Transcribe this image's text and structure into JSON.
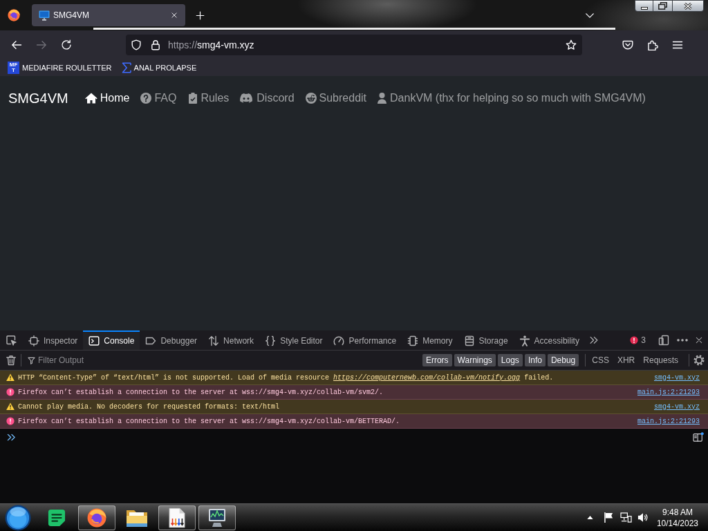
{
  "browser": {
    "tabs": [
      {
        "title": "SMG4VM",
        "selected": true
      }
    ],
    "nav_buttons": [
      {
        "kind": "back",
        "disabled": false
      },
      {
        "kind": "forward",
        "disabled": true
      },
      {
        "kind": "reload",
        "disabled": false
      }
    ],
    "address": {
      "scheme": "https://",
      "host": "smg4-vm.xyz"
    },
    "bookmarks": [
      {
        "kind": "letters",
        "icon_text": [
          "MF",
          "T"
        ],
        "label": "MEDIAFIRE ROULETTER"
      },
      {
        "kind": "sigma",
        "label": "ANAL PROLAPSE"
      }
    ]
  },
  "page": {
    "brand": "SMG4VM",
    "nav": [
      {
        "kind": "home",
        "label": "Home",
        "selected": true
      },
      {
        "kind": "help",
        "label": "FAQ",
        "selected": false
      },
      {
        "kind": "rules",
        "label": "Rules",
        "selected": false
      },
      {
        "kind": "chat",
        "label": "Discord",
        "selected": false
      },
      {
        "kind": "forum",
        "label": "Subreddit",
        "selected": false
      },
      {
        "kind": "user",
        "label": "DankVM (thx for helping so so much with SMG4VM)",
        "selected": false
      }
    ]
  },
  "devtools": {
    "tools": [
      {
        "kind": "inspector",
        "label": "Inspector",
        "selected": false
      },
      {
        "kind": "console",
        "label": "Console",
        "selected": true
      },
      {
        "kind": "debugger",
        "label": "Debugger",
        "selected": false
      },
      {
        "kind": "network",
        "label": "Network",
        "selected": false
      },
      {
        "kind": "style",
        "label": "Style Editor",
        "selected": false
      },
      {
        "kind": "performance",
        "label": "Performance",
        "selected": false
      },
      {
        "kind": "memory",
        "label": "Memory",
        "selected": false
      },
      {
        "kind": "storage",
        "label": "Storage",
        "selected": false
      },
      {
        "kind": "accessibility",
        "label": "Accessibility",
        "selected": false
      }
    ],
    "error_count": "3",
    "filter": {
      "placeholder": "Filter Output"
    },
    "levels": [
      {
        "label": "Errors",
        "selected": true
      },
      {
        "label": "Warnings",
        "selected": true
      },
      {
        "label": "Logs",
        "selected": true
      },
      {
        "label": "Info",
        "selected": true
      },
      {
        "label": "Debug",
        "selected": true
      }
    ],
    "request_filters": [
      {
        "label": "CSS",
        "selected": false
      },
      {
        "label": "XHR",
        "selected": false
      },
      {
        "label": "Requests",
        "selected": false
      }
    ],
    "messages": [
      {
        "kind": "warning",
        "text": "HTTP “Content-Type” of “text/html” is not supported. Load of media resource ",
        "link": "https://computernewb.com/collab-vm/notify.ogg",
        "text_after": " failed.",
        "source": "smg4-vm.xyz"
      },
      {
        "kind": "error",
        "text": "Firefox can’t establish a connection to the server at wss://smg4-vm.xyz/collab-vm/svm2/.",
        "source": "main.js:2:21293"
      },
      {
        "kind": "warning",
        "text": "Cannot play media. No decoders for requested formats: text/html",
        "source": "smg4-vm.xyz"
      },
      {
        "kind": "error",
        "text": "Firefox can’t establish a connection to the server at wss://smg4-vm.xyz/collab-vm/BETTERAD/.",
        "source": "main.js:2:21293"
      }
    ]
  },
  "taskbar": {
    "apps": [
      {
        "kind": "notes",
        "running": false
      },
      {
        "kind": "browser",
        "running": true
      },
      {
        "kind": "folder",
        "running": false
      },
      {
        "kind": "document",
        "running": true
      },
      {
        "kind": "monitor",
        "running": true
      }
    ],
    "time": "9:48 AM",
    "date": "10/14/2023"
  }
}
